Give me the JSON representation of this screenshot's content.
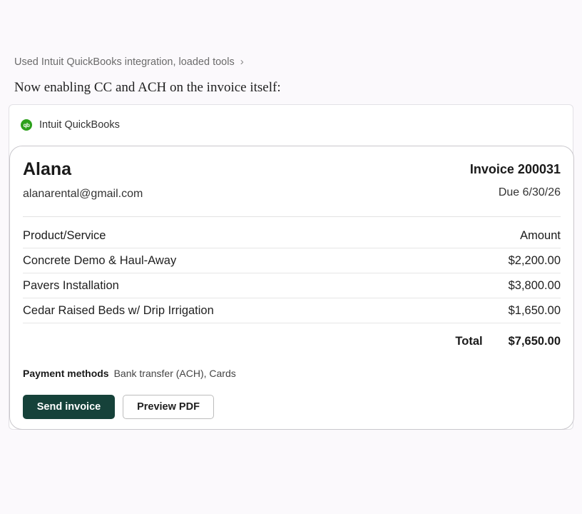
{
  "tool_status": {
    "text": "Used Intuit QuickBooks integration, loaded tools",
    "chevron": "›"
  },
  "message": "Now enabling CC and ACH on the invoice itself:",
  "integration": {
    "name": "Intuit QuickBooks",
    "logo_text": "qb",
    "logo_color": "#2ca01c"
  },
  "invoice": {
    "client_name": "Alana",
    "client_email": "alanarental@gmail.com",
    "number": "Invoice 200031",
    "due": "Due 6/30/26",
    "columns": {
      "product": "Product/Service",
      "amount": "Amount"
    },
    "items": [
      {
        "name": "Concrete Demo & Haul-Away",
        "amount": "$2,200.00"
      },
      {
        "name": "Pavers Installation",
        "amount": "$3,800.00"
      },
      {
        "name": "Cedar Raised Beds w/ Drip Irrigation",
        "amount": "$1,650.00"
      }
    ],
    "total_label": "Total",
    "total_value": "$7,650.00",
    "payment_label": "Payment methods",
    "payment_value": "Bank transfer (ACH), Cards"
  },
  "actions": {
    "send": "Send invoice",
    "preview": "Preview PDF",
    "primary_color": "#16423a"
  }
}
